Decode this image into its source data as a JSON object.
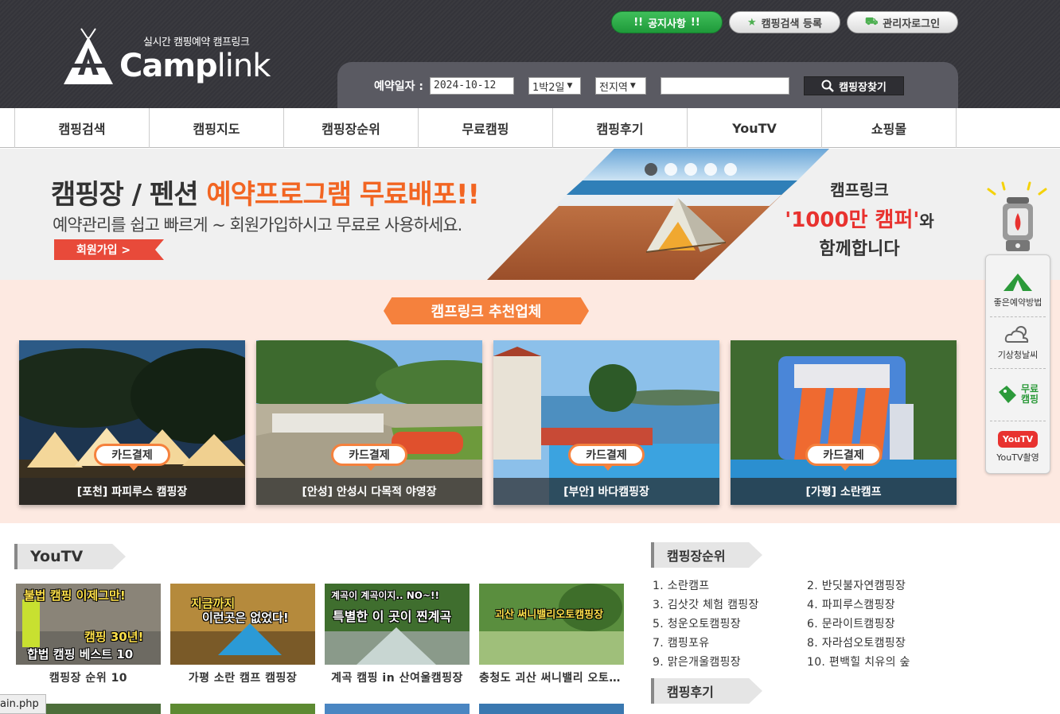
{
  "header": {
    "tagline": "실시간 캠핑예약 캠프링크",
    "brand_a": "Camp",
    "brand_b": "link",
    "top_buttons": {
      "notice": "공지사항",
      "notice_marks": "!!",
      "register": "캠핑검색 등록",
      "admin_login": "관리자로그인"
    }
  },
  "search": {
    "label": "예약일자 :",
    "date": "2024-10-12",
    "nights": "1박2일",
    "region": "전지역",
    "keyword": "",
    "button": "캠핑장찾기"
  },
  "nav": [
    "캠핑검색",
    "캠핑지도",
    "캠핑장순위",
    "무료캠핑",
    "캠핑후기",
    "YouTV",
    "쇼핑몰"
  ],
  "banner": {
    "line1_a": "캠핑장 / 펜션 ",
    "line1_b": "예약프로그램 무료배포!!",
    "line2": "예약관리를 쉽고 빠르게 ~ 회원가입하시고 무료로 사용하세요.",
    "join": "회원가입 >",
    "right1": "캠프링크",
    "right2_a": "'1000만 캠퍼'",
    "right2_b": "와",
    "right3": "함께합니다",
    "slides": 5,
    "active_slide": 1
  },
  "recommended": {
    "title": "캠프링크 추천업체",
    "badge": "카드결제",
    "items": [
      "[포천] 파피루스 캠핑장",
      "[안성] 안성시 다목적 야영장",
      "[부안] 바다캠핑장",
      "[가평] 소란캠프"
    ]
  },
  "side_widget": {
    "items": [
      "좋은예약방법",
      "기상청날씨",
      "무료 캠핑",
      "YouTV촬영"
    ],
    "free_a": "무료",
    "free_b": "캠핑",
    "youtv_logo": "YouTV"
  },
  "youtv": {
    "title": "YouTV",
    "videos": [
      {
        "title": "캠핑장 순위 10",
        "thumb_top": "불법 캠핑 이제그만!",
        "thumb_mid": "캠핑 30년!",
        "thumb_bot": "합법 캠핑 베스트 10"
      },
      {
        "title": "가평 소란 캠프 캠핑장",
        "thumb_top": "지금까지",
        "thumb_mid": "이런곳은 없었다!",
        "thumb_bot": ""
      },
      {
        "title": "계곡 캠핑 in 산여울캠핑장",
        "thumb_top": "계곡이 계곡이지.. NO~!!",
        "thumb_mid": "특별한 이 곳이 찐계곡",
        "thumb_bot": ""
      },
      {
        "title": "충청도 괴산 써니밸리 오토캠핑장",
        "thumb_top": "괴산 써니밸리오토캠핑장",
        "thumb_mid": "",
        "thumb_bot": ""
      }
    ]
  },
  "ranking": {
    "title": "캠핑장순위",
    "items": [
      "1. 소란캠프",
      "2. 반딧불자연캠핑장",
      "3. 김삿갓 체험 캠핑장",
      "4. 파피루스캠핑장",
      "5. 청운오토캠핑장",
      "6. 문라이트캠핑장",
      "7. 캠핑포유",
      "8. 자라섬오토캠핑장",
      "9. 맑은개울캠핑장",
      "10. 편백힐 치유의 숲"
    ]
  },
  "review": {
    "title": "캠핑후기"
  },
  "status_bar": "ain.php",
  "colors": {
    "accent": "#f5813d",
    "header_bg": "#36363c",
    "notice_green": "#2aa946",
    "reco_bg": "#fde9e1"
  }
}
